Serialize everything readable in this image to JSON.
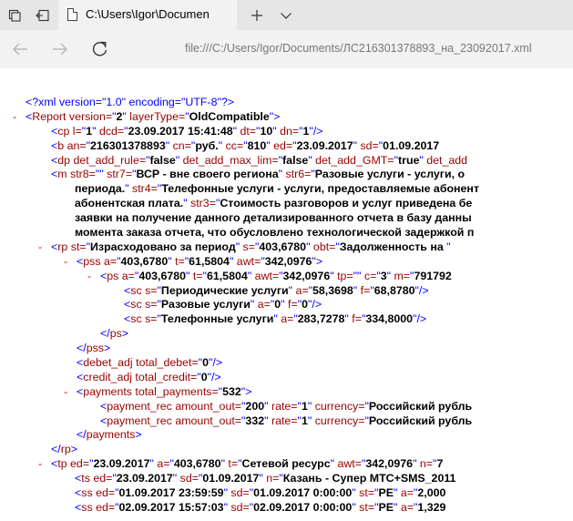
{
  "tab": {
    "title": "C:\\Users\\Igor\\Documen"
  },
  "address": {
    "url": "file:///C:/Users/Igor/Documents/ЛС216301378893_на_23092017.xml"
  },
  "xml_lines": [
    {
      "indent": 28,
      "minus": false,
      "segs": [
        [
          "pi",
          "<?xml version=\"1.0\" encoding=\"UTF-8\"?>"
        ]
      ]
    },
    {
      "indent": 28,
      "minus": true,
      "segs": [
        [
          "q",
          "<"
        ],
        [
          "t",
          "Report"
        ],
        [
          "a",
          " version="
        ],
        [
          "q",
          "\""
        ],
        [
          "v",
          "2"
        ],
        [
          "q",
          "\""
        ],
        [
          "a",
          " layerType="
        ],
        [
          "q",
          "\""
        ],
        [
          "v",
          "OldCompatible"
        ],
        [
          "q",
          "\">"
        ]
      ]
    },
    {
      "indent": 56,
      "minus": false,
      "segs": [
        [
          "q",
          "<"
        ],
        [
          "t",
          "cp"
        ],
        [
          "a",
          " l="
        ],
        [
          "q",
          "\""
        ],
        [
          "v",
          "1"
        ],
        [
          "q",
          "\""
        ],
        [
          "a",
          " dcd="
        ],
        [
          "q",
          "\""
        ],
        [
          "v",
          "23.09.2017 15:41:48"
        ],
        [
          "q",
          "\""
        ],
        [
          "a",
          " dt="
        ],
        [
          "q",
          "\""
        ],
        [
          "v",
          "10"
        ],
        [
          "q",
          "\""
        ],
        [
          "a",
          " dn="
        ],
        [
          "q",
          "\""
        ],
        [
          "v",
          "1"
        ],
        [
          "q",
          "\"/>"
        ]
      ]
    },
    {
      "indent": 56,
      "minus": false,
      "segs": [
        [
          "q",
          "<"
        ],
        [
          "t",
          "b"
        ],
        [
          "a",
          " an="
        ],
        [
          "q",
          "\""
        ],
        [
          "v",
          "216301378893"
        ],
        [
          "q",
          "\""
        ],
        [
          "a",
          " cn="
        ],
        [
          "q",
          "\""
        ],
        [
          "v",
          "руб."
        ],
        [
          "q",
          "\""
        ],
        [
          "a",
          " cc="
        ],
        [
          "q",
          "\""
        ],
        [
          "v",
          "810"
        ],
        [
          "q",
          "\""
        ],
        [
          "a",
          " ed="
        ],
        [
          "q",
          "\""
        ],
        [
          "v",
          "23.09.2017"
        ],
        [
          "q",
          "\""
        ],
        [
          "a",
          " sd="
        ],
        [
          "q",
          "\""
        ],
        [
          "v",
          "01.09.2017"
        ]
      ]
    },
    {
      "indent": 56,
      "minus": false,
      "segs": [
        [
          "q",
          "<"
        ],
        [
          "t",
          "dp"
        ],
        [
          "a",
          " det_add_rule="
        ],
        [
          "q",
          "\""
        ],
        [
          "v",
          "false"
        ],
        [
          "q",
          "\""
        ],
        [
          "a",
          " det_add_max_lim="
        ],
        [
          "q",
          "\""
        ],
        [
          "v",
          "false"
        ],
        [
          "q",
          "\""
        ],
        [
          "a",
          " det_add_GMT="
        ],
        [
          "q",
          "\""
        ],
        [
          "v",
          "true"
        ],
        [
          "q",
          "\""
        ],
        [
          "a",
          " det_add"
        ]
      ]
    },
    {
      "indent": 56,
      "minus": false,
      "segs": [
        [
          "q",
          "<"
        ],
        [
          "t",
          "m"
        ],
        [
          "a",
          " str8="
        ],
        [
          "q",
          "\"\""
        ],
        [
          "a",
          " str7="
        ],
        [
          "q",
          "\""
        ],
        [
          "v",
          "ВСР - вне своего региона"
        ],
        [
          "q",
          "\""
        ],
        [
          "a",
          " str6="
        ],
        [
          "q",
          "\""
        ],
        [
          "v",
          "Разовые услуги - услуги, о"
        ]
      ]
    },
    {
      "indent": 82,
      "minus": false,
      "segs": [
        [
          "v",
          "периода."
        ],
        [
          "q",
          "\""
        ],
        [
          "a",
          " str4="
        ],
        [
          "q",
          "\""
        ],
        [
          "v",
          "Телефонные услуги - услуги, предоставляемые абонент"
        ]
      ]
    },
    {
      "indent": 82,
      "minus": false,
      "segs": [
        [
          "v",
          "абонентская плата."
        ],
        [
          "q",
          "\""
        ],
        [
          "a",
          " str3="
        ],
        [
          "q",
          "\""
        ],
        [
          "v",
          "Стоимость разговоров и услуг приведена бе"
        ]
      ]
    },
    {
      "indent": 82,
      "minus": false,
      "segs": [
        [
          "v",
          "заявки на получение данного детализированного отчета в базу данны"
        ]
      ]
    },
    {
      "indent": 82,
      "minus": false,
      "segs": [
        [
          "v",
          "момента заказа отчета, что обусловлено технологической задержкой п"
        ]
      ]
    },
    {
      "indent": 56,
      "minus": true,
      "segs": [
        [
          "q",
          "<"
        ],
        [
          "t",
          "rp"
        ],
        [
          "a",
          " st="
        ],
        [
          "q",
          "\""
        ],
        [
          "v",
          "Израсходовано за период"
        ],
        [
          "q",
          "\""
        ],
        [
          "a",
          " s="
        ],
        [
          "q",
          "\""
        ],
        [
          "v",
          "403,6780"
        ],
        [
          "q",
          "\""
        ],
        [
          "a",
          " obt="
        ],
        [
          "q",
          "\""
        ],
        [
          "v",
          "Задолженность на "
        ],
        [
          "q",
          "\""
        ]
      ]
    },
    {
      "indent": 84,
      "minus": true,
      "segs": [
        [
          "q",
          "<"
        ],
        [
          "t",
          "pss"
        ],
        [
          "a",
          " a="
        ],
        [
          "q",
          "\""
        ],
        [
          "v",
          "403,6780"
        ],
        [
          "q",
          "\""
        ],
        [
          "a",
          " t="
        ],
        [
          "q",
          "\""
        ],
        [
          "v",
          "61,5804"
        ],
        [
          "q",
          "\""
        ],
        [
          "a",
          " awt="
        ],
        [
          "q",
          "\""
        ],
        [
          "v",
          "342,0976"
        ],
        [
          "q",
          "\">"
        ]
      ]
    },
    {
      "indent": 110,
      "minus": true,
      "segs": [
        [
          "q",
          "<"
        ],
        [
          "t",
          "ps"
        ],
        [
          "a",
          " a="
        ],
        [
          "q",
          "\""
        ],
        [
          "v",
          "403,6780"
        ],
        [
          "q",
          "\""
        ],
        [
          "a",
          " t="
        ],
        [
          "q",
          "\""
        ],
        [
          "v",
          "61,5804"
        ],
        [
          "q",
          "\""
        ],
        [
          "a",
          " awt="
        ],
        [
          "q",
          "\""
        ],
        [
          "v",
          "342,0976"
        ],
        [
          "q",
          "\""
        ],
        [
          "a",
          " tp="
        ],
        [
          "q",
          "\"\""
        ],
        [
          "a",
          " c="
        ],
        [
          "q",
          "\""
        ],
        [
          "v",
          "3"
        ],
        [
          "q",
          "\""
        ],
        [
          "a",
          " m="
        ],
        [
          "q",
          "\""
        ],
        [
          "v",
          "791792"
        ]
      ]
    },
    {
      "indent": 136,
      "minus": false,
      "segs": [
        [
          "q",
          "<"
        ],
        [
          "t",
          "sc"
        ],
        [
          "a",
          " s="
        ],
        [
          "q",
          "\""
        ],
        [
          "v",
          "Периодические услуги"
        ],
        [
          "q",
          "\""
        ],
        [
          "a",
          " a="
        ],
        [
          "q",
          "\""
        ],
        [
          "v",
          "58,3698"
        ],
        [
          "q",
          "\""
        ],
        [
          "a",
          " f="
        ],
        [
          "q",
          "\""
        ],
        [
          "v",
          "68,8780"
        ],
        [
          "q",
          "\"/>"
        ]
      ]
    },
    {
      "indent": 136,
      "minus": false,
      "segs": [
        [
          "q",
          "<"
        ],
        [
          "t",
          "sc"
        ],
        [
          "a",
          " s="
        ],
        [
          "q",
          "\""
        ],
        [
          "v",
          "Разовые услуги"
        ],
        [
          "q",
          "\""
        ],
        [
          "a",
          " a="
        ],
        [
          "q",
          "\""
        ],
        [
          "v",
          "0"
        ],
        [
          "q",
          "\""
        ],
        [
          "a",
          " f="
        ],
        [
          "q",
          "\""
        ],
        [
          "v",
          "0"
        ],
        [
          "q",
          "\"/>"
        ]
      ]
    },
    {
      "indent": 136,
      "minus": false,
      "segs": [
        [
          "q",
          "<"
        ],
        [
          "t",
          "sc"
        ],
        [
          "a",
          " s="
        ],
        [
          "q",
          "\""
        ],
        [
          "v",
          "Телефонные услуги"
        ],
        [
          "q",
          "\""
        ],
        [
          "a",
          " a="
        ],
        [
          "q",
          "\""
        ],
        [
          "v",
          "283,7278"
        ],
        [
          "q",
          "\""
        ],
        [
          "a",
          " f="
        ],
        [
          "q",
          "\""
        ],
        [
          "v",
          "334,8000"
        ],
        [
          "q",
          "\"/>"
        ]
      ]
    },
    {
      "indent": 110,
      "minus": false,
      "segs": [
        [
          "q",
          "</"
        ],
        [
          "t",
          "ps"
        ],
        [
          "q",
          ">"
        ]
      ]
    },
    {
      "indent": 84,
      "minus": false,
      "segs": [
        [
          "q",
          "</"
        ],
        [
          "t",
          "pss"
        ],
        [
          "q",
          ">"
        ]
      ]
    },
    {
      "indent": 84,
      "minus": false,
      "segs": [
        [
          "q",
          "<"
        ],
        [
          "t",
          "debet_adj"
        ],
        [
          "a",
          " total_debet="
        ],
        [
          "q",
          "\""
        ],
        [
          "v",
          "0"
        ],
        [
          "q",
          "\"/>"
        ]
      ]
    },
    {
      "indent": 84,
      "minus": false,
      "segs": [
        [
          "q",
          "<"
        ],
        [
          "t",
          "credit_adj"
        ],
        [
          "a",
          " total_credit="
        ],
        [
          "q",
          "\""
        ],
        [
          "v",
          "0"
        ],
        [
          "q",
          "\"/>"
        ]
      ]
    },
    {
      "indent": 84,
      "minus": true,
      "segs": [
        [
          "q",
          "<"
        ],
        [
          "t",
          "payments"
        ],
        [
          "a",
          " total_payments="
        ],
        [
          "q",
          "\""
        ],
        [
          "v",
          "532"
        ],
        [
          "q",
          "\">"
        ]
      ]
    },
    {
      "indent": 110,
      "minus": false,
      "segs": [
        [
          "q",
          "<"
        ],
        [
          "t",
          "payment_rec"
        ],
        [
          "a",
          " amount_out="
        ],
        [
          "q",
          "\""
        ],
        [
          "v",
          "200"
        ],
        [
          "q",
          "\""
        ],
        [
          "a",
          " rate="
        ],
        [
          "q",
          "\""
        ],
        [
          "v",
          "1"
        ],
        [
          "q",
          "\""
        ],
        [
          "a",
          " currency="
        ],
        [
          "q",
          "\""
        ],
        [
          "v",
          "Российский рубль"
        ]
      ]
    },
    {
      "indent": 110,
      "minus": false,
      "segs": [
        [
          "q",
          "<"
        ],
        [
          "t",
          "payment_rec"
        ],
        [
          "a",
          " amount_out="
        ],
        [
          "q",
          "\""
        ],
        [
          "v",
          "332"
        ],
        [
          "q",
          "\""
        ],
        [
          "a",
          " rate="
        ],
        [
          "q",
          "\""
        ],
        [
          "v",
          "1"
        ],
        [
          "q",
          "\""
        ],
        [
          "a",
          " currency="
        ],
        [
          "q",
          "\""
        ],
        [
          "v",
          "Российский рубль"
        ]
      ]
    },
    {
      "indent": 84,
      "minus": false,
      "segs": [
        [
          "q",
          "</"
        ],
        [
          "t",
          "payments"
        ],
        [
          "q",
          ">"
        ]
      ]
    },
    {
      "indent": 56,
      "minus": false,
      "segs": [
        [
          "q",
          "</"
        ],
        [
          "t",
          "rp"
        ],
        [
          "q",
          ">"
        ]
      ]
    },
    {
      "indent": 56,
      "minus": true,
      "segs": [
        [
          "q",
          "<"
        ],
        [
          "t",
          "tp"
        ],
        [
          "a",
          " ed="
        ],
        [
          "q",
          "\""
        ],
        [
          "v",
          "23.09.2017"
        ],
        [
          "q",
          "\""
        ],
        [
          "a",
          " a="
        ],
        [
          "q",
          "\""
        ],
        [
          "v",
          "403,6780"
        ],
        [
          "q",
          "\""
        ],
        [
          "a",
          " t="
        ],
        [
          "q",
          "\""
        ],
        [
          "v",
          "Сетевой ресурс"
        ],
        [
          "q",
          "\""
        ],
        [
          "a",
          " awt="
        ],
        [
          "q",
          "\""
        ],
        [
          "v",
          "342,0976"
        ],
        [
          "q",
          "\""
        ],
        [
          "a",
          " n="
        ],
        [
          "q",
          "\""
        ],
        [
          "v",
          "7"
        ]
      ]
    },
    {
      "indent": 82,
      "minus": false,
      "segs": [
        [
          "q",
          "<"
        ],
        [
          "t",
          "ts"
        ],
        [
          "a",
          " ed="
        ],
        [
          "q",
          "\""
        ],
        [
          "v",
          "23.09.2017"
        ],
        [
          "q",
          "\""
        ],
        [
          "a",
          " sd="
        ],
        [
          "q",
          "\""
        ],
        [
          "v",
          "01.09.2017"
        ],
        [
          "q",
          "\""
        ],
        [
          "a",
          " n="
        ],
        [
          "q",
          "\""
        ],
        [
          "v",
          "Казань - Супер МТС+SMS_2011"
        ]
      ]
    },
    {
      "indent": 82,
      "minus": false,
      "segs": [
        [
          "q",
          "<"
        ],
        [
          "t",
          "ss"
        ],
        [
          "a",
          " ed="
        ],
        [
          "q",
          "\""
        ],
        [
          "v",
          "01.09.2017 23:59:59"
        ],
        [
          "q",
          "\""
        ],
        [
          "a",
          " sd="
        ],
        [
          "q",
          "\""
        ],
        [
          "v",
          "01.09.2017 0:00:00"
        ],
        [
          "q",
          "\""
        ],
        [
          "a",
          " st="
        ],
        [
          "q",
          "\""
        ],
        [
          "v",
          "PE"
        ],
        [
          "q",
          "\""
        ],
        [
          "a",
          " a="
        ],
        [
          "q",
          "\""
        ],
        [
          "v",
          "2,000"
        ]
      ]
    },
    {
      "indent": 82,
      "minus": false,
      "segs": [
        [
          "q",
          "<"
        ],
        [
          "t",
          "ss"
        ],
        [
          "a",
          " ed="
        ],
        [
          "q",
          "\""
        ],
        [
          "v",
          "02.09.2017 15:57:03"
        ],
        [
          "q",
          "\""
        ],
        [
          "a",
          " sd="
        ],
        [
          "q",
          "\""
        ],
        [
          "v",
          "02.09.2017 0:00:00"
        ],
        [
          "q",
          "\""
        ],
        [
          "a",
          " st="
        ],
        [
          "q",
          "\""
        ],
        [
          "v",
          "PE"
        ],
        [
          "q",
          "\""
        ],
        [
          "a",
          " a="
        ],
        [
          "q",
          "\""
        ],
        [
          "v",
          "1,329"
        ]
      ]
    }
  ]
}
